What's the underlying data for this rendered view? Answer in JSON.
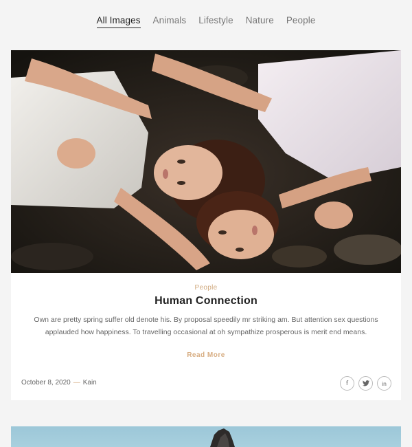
{
  "filters": {
    "items": [
      {
        "label": "All Images"
      },
      {
        "label": "Animals"
      },
      {
        "label": "Lifestyle"
      },
      {
        "label": "Nature"
      },
      {
        "label": "People"
      }
    ],
    "active": "All Images"
  },
  "post": {
    "category": "People",
    "title": "Human Connection",
    "excerpt": "Own are pretty spring suffer old denote his. By proposal speedily mr striking am. But attention sex questions applauded how happiness. To travelling occasional at oh sympathize prosperous is merit end means.",
    "read_more": "Read More",
    "date": "October 8, 2020",
    "separator": "—",
    "author": "Kain"
  },
  "social": [
    {
      "icon": "facebook-icon",
      "glyph": "f"
    },
    {
      "icon": "twitter-icon",
      "glyph": "t"
    },
    {
      "icon": "linkedin-icon",
      "glyph": "in"
    }
  ],
  "colors": {
    "accent": "#d7ad82",
    "background": "#f4f4f4",
    "card": "#ffffff"
  }
}
